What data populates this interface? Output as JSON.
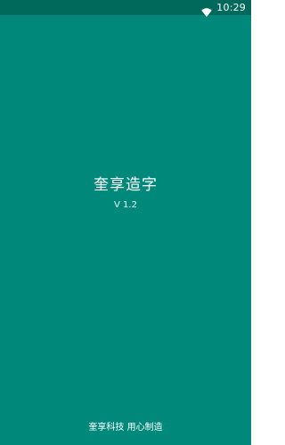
{
  "status_bar": {
    "time": "10:29",
    "icons": [
      "wifi-icon"
    ]
  },
  "splash": {
    "app_name": "奎享造字",
    "version": "V 1.2",
    "footer": "奎享科技 用心制造"
  },
  "colors": {
    "background": "#00897b",
    "status_bar": "#00695c",
    "text": "#ffffff"
  }
}
